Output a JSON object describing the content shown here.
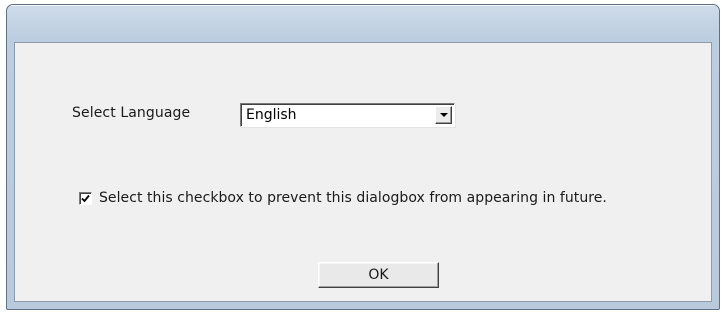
{
  "dialog": {
    "language_label": "Select Language",
    "language_select": {
      "selected": "English",
      "options": [
        "English"
      ]
    },
    "checkbox": {
      "checked": true,
      "label": "Select this checkbox to prevent this dialogbox from appearing in future."
    },
    "ok_label": "OK"
  },
  "colors": {
    "frame": "#bccde0",
    "client": "#f0f0f0",
    "button_face": "#e9e9e9"
  }
}
